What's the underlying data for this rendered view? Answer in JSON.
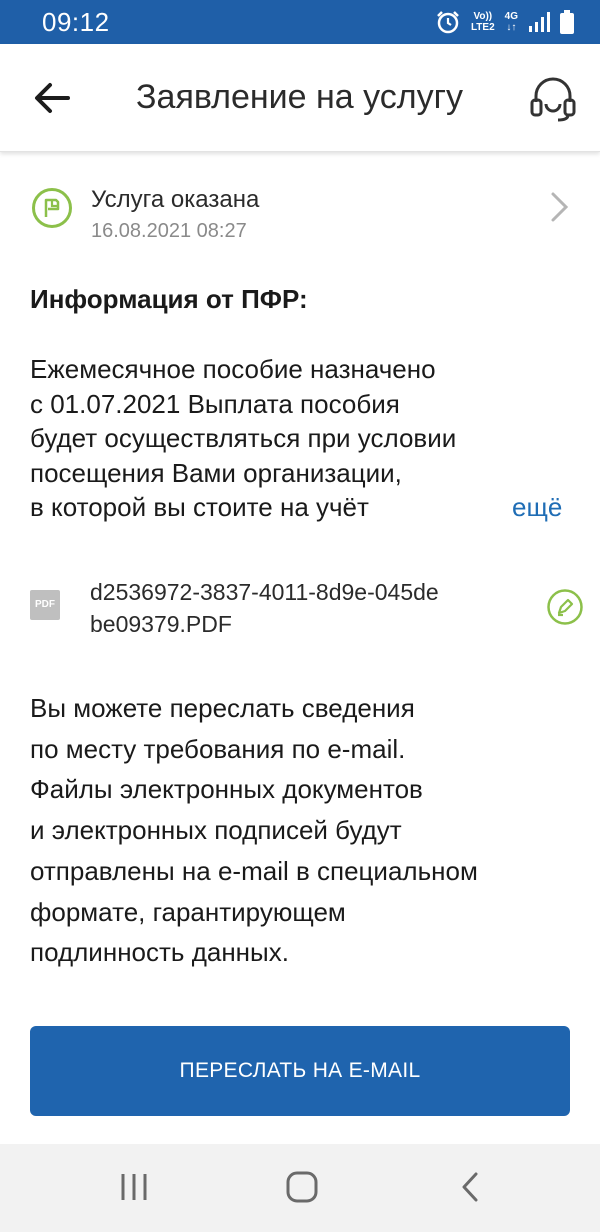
{
  "status_bar": {
    "time": "09:12",
    "network_top": "Vo))",
    "network_bottom": "LTE2",
    "network_type": "4G"
  },
  "app_bar": {
    "title": "Заявление на услугу",
    "back_icon": "arrow-left-icon",
    "support_icon": "headset-icon"
  },
  "service_status": {
    "title": "Услуга оказана",
    "date": "16.08.2021 08:27",
    "icon": "flag-circle-icon",
    "accent_color": "#8cc04a"
  },
  "info": {
    "heading": "Информация от ПФР:",
    "lines": [
      "Ежемесячное пособие назначено",
      "с 01.07.2021 Выплата пособия",
      "будет осуществляться при условии",
      "посещения Вами организации,",
      "в которой вы стоите на учёт"
    ],
    "more_label": "ещё",
    "link_color": "#1f6db5"
  },
  "attachment": {
    "icon_label": "PDF",
    "name_lines": [
      "d2536972-3837-4011-8d9e-045de",
      "be09379.PDF"
    ],
    "sign_icon": "signature-pen-icon"
  },
  "email_info": {
    "lines": [
      "Вы можете переслать сведения",
      "по месту требования по e-mail.",
      "Файлы электронных документов",
      "и электронных подписей будут",
      "отправлены на e-mail в специальном",
      "формате, гарантирующем",
      "подлинность данных."
    ]
  },
  "actions": {
    "forward_label": "ПЕРЕСЛАТЬ НА E-MAIL",
    "button_color": "#1f64ae"
  },
  "nav_bar": {
    "recents_icon": "recents-icon",
    "home_icon": "home-icon",
    "back_icon": "back-chevron-icon"
  }
}
